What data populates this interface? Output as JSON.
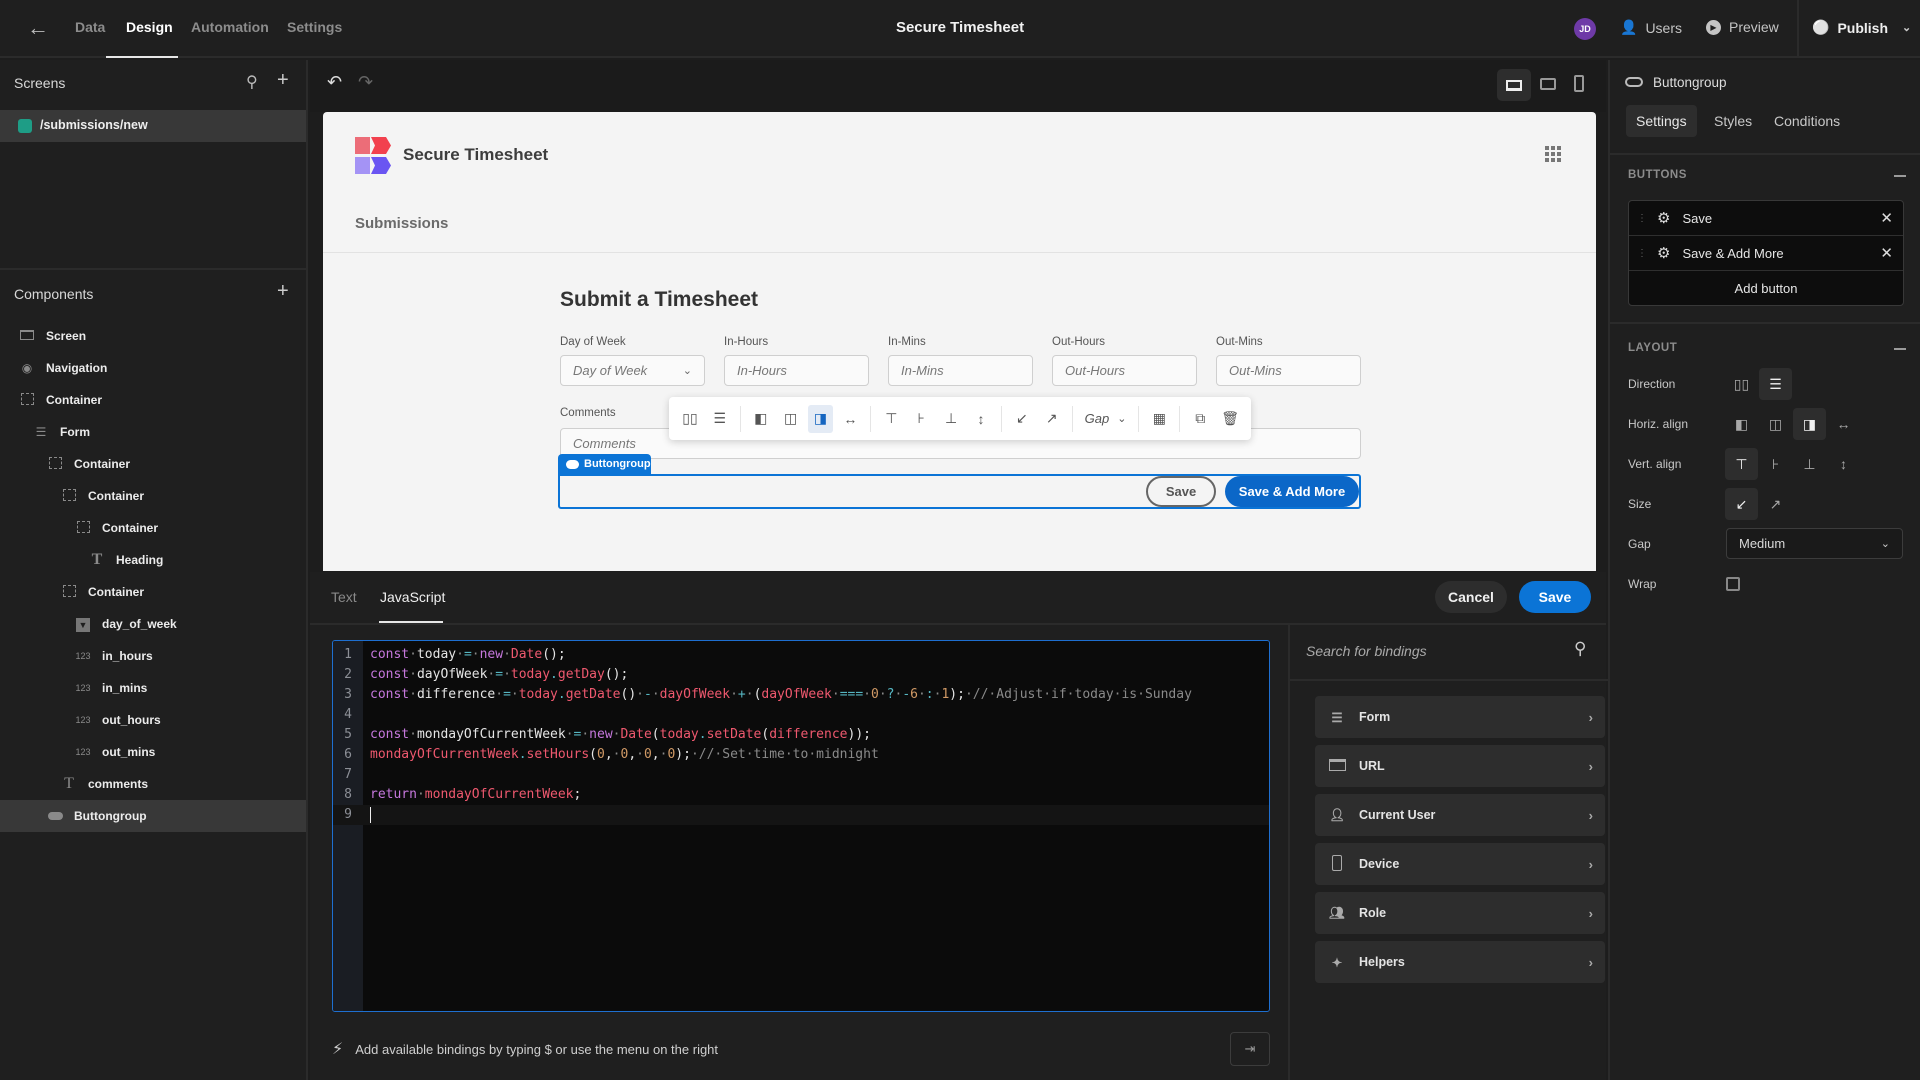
{
  "topbar": {
    "back_icon": "arrow-left-icon",
    "tabs": [
      {
        "label": "Data"
      },
      {
        "label": "Design"
      },
      {
        "label": "Automation"
      },
      {
        "label": "Settings"
      }
    ],
    "active_tab": "Design",
    "app_title": "Secure Timesheet",
    "avatar_initials": "JD",
    "users_label": "Users",
    "preview_label": "Preview",
    "publish_label": "Publish"
  },
  "screens": {
    "title": "Screens",
    "items": [
      {
        "route": "/submissions/new",
        "color": "#1e9d86"
      }
    ]
  },
  "components": {
    "title": "Components",
    "items": [
      {
        "label": "Screen",
        "icon": "screen-icon",
        "depth": 0
      },
      {
        "label": "Navigation",
        "icon": "eye-icon",
        "depth": 0
      },
      {
        "label": "Container",
        "icon": "container-icon",
        "depth": 0
      },
      {
        "label": "Form",
        "icon": "form-icon",
        "depth": 1
      },
      {
        "label": "Container",
        "icon": "container-icon",
        "depth": 2
      },
      {
        "label": "Container",
        "icon": "container-icon",
        "depth": 3
      },
      {
        "label": "Container",
        "icon": "container-icon",
        "depth": 4
      },
      {
        "label": "Heading",
        "icon": "text-icon",
        "depth": 5
      },
      {
        "label": "Container",
        "icon": "container-icon",
        "depth": 3
      },
      {
        "label": "day_of_week",
        "icon": "dropdown-icon",
        "depth": 4
      },
      {
        "label": "in_hours",
        "icon": "number-icon",
        "depth": 4
      },
      {
        "label": "in_mins",
        "icon": "number-icon",
        "depth": 4
      },
      {
        "label": "out_hours",
        "icon": "number-icon",
        "depth": 4
      },
      {
        "label": "out_mins",
        "icon": "number-icon",
        "depth": 4
      },
      {
        "label": "comments",
        "icon": "text-icon",
        "depth": 3
      },
      {
        "label": "Buttongroup",
        "icon": "button-icon",
        "depth": 2,
        "selected": true
      }
    ],
    "number_glyph": "123"
  },
  "canvas": {
    "app_name": "Secure Timesheet",
    "nav_link": "Submissions",
    "form_title": "Submit a Timesheet",
    "fields": [
      {
        "label": "Day of Week",
        "placeholder": "Day of Week",
        "type": "select"
      },
      {
        "label": "In-Hours",
        "placeholder": "In-Hours",
        "type": "number"
      },
      {
        "label": "In-Mins",
        "placeholder": "In-Mins",
        "type": "number"
      },
      {
        "label": "Out-Hours",
        "placeholder": "Out-Hours",
        "type": "number"
      },
      {
        "label": "Out-Mins",
        "placeholder": "Out-Mins",
        "type": "number"
      }
    ],
    "comments_label": "Comments",
    "comments_placeholder": "Comments",
    "toolbar_gap_label": "Gap",
    "selected_tag": "Buttongroup",
    "buttons": {
      "save": "Save",
      "save_add": "Save & Add More"
    }
  },
  "editor": {
    "tabs": [
      {
        "label": "Text"
      },
      {
        "label": "JavaScript"
      }
    ],
    "active_tab": "JavaScript",
    "cancel_label": "Cancel",
    "save_label": "Save",
    "code_lines": [
      "const today = new Date();",
      "const dayOfWeek = today.getDay();",
      "const difference = today.getDate() - dayOfWeek + (dayOfWeek === 0 ? -6 : 1); // Adjust if today is Sunday",
      "",
      "const mondayOfCurrentWeek = new Date(today.setDate(difference));",
      "mondayOfCurrentWeek.setHours(0, 0, 0, 0); // Set time to midnight",
      "",
      "return mondayOfCurrentWeek;",
      ""
    ],
    "hint": "Add available bindings by typing $ or use the menu on the right",
    "bindings_search_placeholder": "Search for bindings",
    "bindings": [
      {
        "label": "Form",
        "icon": "form-icon"
      },
      {
        "label": "URL",
        "icon": "browser-icon"
      },
      {
        "label": "Current User",
        "icon": "user-icon"
      },
      {
        "label": "Device",
        "icon": "device-icon"
      },
      {
        "label": "Role",
        "icon": "role-icon"
      },
      {
        "label": "Helpers",
        "icon": "magic-wand-icon"
      }
    ]
  },
  "settings": {
    "component_name": "Buttongroup",
    "tabs": [
      {
        "label": "Settings"
      },
      {
        "label": "Styles"
      },
      {
        "label": "Conditions"
      }
    ],
    "active_tab": "Settings",
    "buttons_section": "BUTTONS",
    "buttons": [
      {
        "label": "Save"
      },
      {
        "label": "Save & Add More"
      }
    ],
    "add_button_label": "Add button",
    "layout_section": "LAYOUT",
    "layout": {
      "direction_label": "Direction",
      "direction": "vertical",
      "horiz_align_label": "Horiz. align",
      "horiz_align": "right",
      "vert_align_label": "Vert. align",
      "vert_align": "top",
      "size_label": "Size",
      "size": "shrink",
      "gap_label": "Gap",
      "gap_value": "Medium",
      "wrap_label": "Wrap",
      "wrap": false
    }
  }
}
